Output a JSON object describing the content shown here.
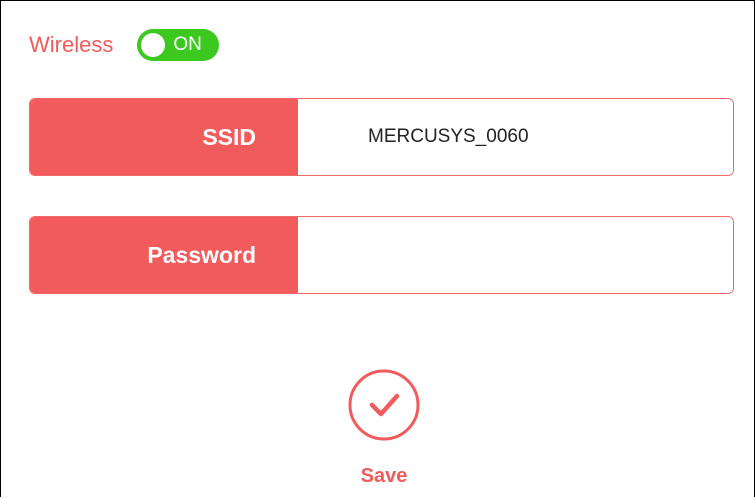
{
  "wireless": {
    "label": "Wireless",
    "toggle_state": "ON",
    "enabled": true
  },
  "form": {
    "ssid": {
      "label": "SSID",
      "value": "MERCUSYS_0060"
    },
    "password": {
      "label": "Password",
      "value": ""
    }
  },
  "save": {
    "label": "Save",
    "icon": "checkmark-circle-icon"
  },
  "colors": {
    "accent": "#f25b5b",
    "toggle_on": "#3cc81e"
  }
}
